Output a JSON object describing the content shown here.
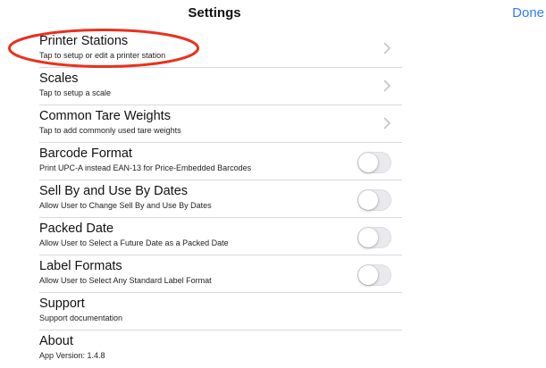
{
  "header": {
    "title": "Settings",
    "done_label": "Done",
    "accent_color": "#2f7cf6"
  },
  "rows": [
    {
      "title": "Printer Stations",
      "subtitle": "Tap to setup or edit a printer station",
      "accessory": "chevron-right-icon"
    },
    {
      "title": "Scales",
      "subtitle": "Tap to setup a scale",
      "accessory": "chevron-right-icon"
    },
    {
      "title": "Common Tare Weights",
      "subtitle": "Tap to add commonly used tare weights",
      "accessory": "chevron-right-icon"
    },
    {
      "title": "Barcode Format",
      "subtitle": "Print UPC-A instead EAN-13 for Price-Embedded Barcodes",
      "accessory": "toggle",
      "toggle_on": false
    },
    {
      "title": "Sell By and Use By Dates",
      "subtitle": "Allow User to Change Sell By and Use By Dates",
      "accessory": "toggle",
      "toggle_on": false
    },
    {
      "title": "Packed Date",
      "subtitle": "Allow User to Select a Future Date as a Packed Date",
      "accessory": "toggle",
      "toggle_on": false
    },
    {
      "title": "Label Formats",
      "subtitle": "Allow User to Select Any Standard Label Format",
      "accessory": "toggle",
      "toggle_on": false
    },
    {
      "title": "Support",
      "subtitle": "Support documentation",
      "accessory": "none"
    },
    {
      "title": "About",
      "subtitle": "App Version: 1.4.8",
      "accessory": "none"
    }
  ],
  "annotation": {
    "shape": "ellipse",
    "color": "#e8321e",
    "target": "Printer Stations"
  }
}
